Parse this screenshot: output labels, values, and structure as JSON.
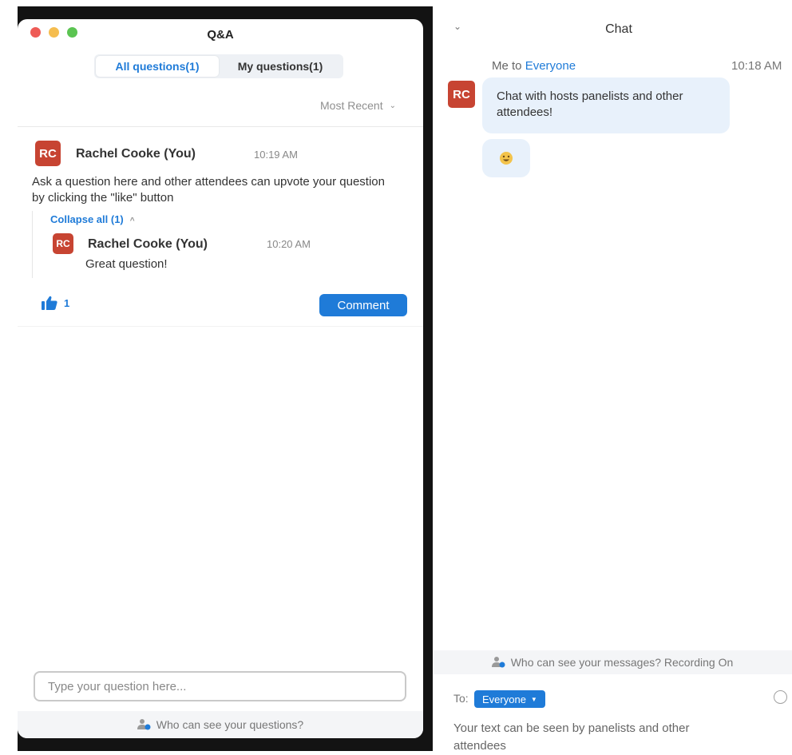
{
  "qa": {
    "title": "Q&A",
    "tabs": [
      {
        "label": "All questions(1)",
        "active": true
      },
      {
        "label": "My questions(1)",
        "active": false
      }
    ],
    "sort_label": "Most Recent",
    "question": {
      "avatar_initials": "RC",
      "author": "Rachel Cooke (You)",
      "time": "10:19 AM",
      "text": "Ask a question here and other attendees can upvote your question by clicking the \"like\" button",
      "collapse_label": "Collapse all (1)",
      "reply": {
        "avatar_initials": "RC",
        "author": "Rachel Cooke (You)",
        "time": "10:20 AM",
        "text": "Great question!"
      },
      "like_count": "1",
      "comment_label": "Comment"
    },
    "input_placeholder": "Type your question here...",
    "footer_text": "Who can see your questions?"
  },
  "chat": {
    "title": "Chat",
    "message": {
      "meta_prefix": "Me to",
      "meta_to": "Everyone",
      "time": "10:18 AM",
      "avatar_initials": "RC",
      "text": "Chat with hosts panelists and other attendees!"
    },
    "status_text": "Who can see your messages? Recording On",
    "to_label": "To:",
    "to_value": "Everyone",
    "hint": "Your text can be seen by panelists and other attendees"
  },
  "colors": {
    "accent_blue": "#1f7bd8",
    "avatar_red": "#c74432",
    "bubble_blue": "#e8f1fb"
  }
}
